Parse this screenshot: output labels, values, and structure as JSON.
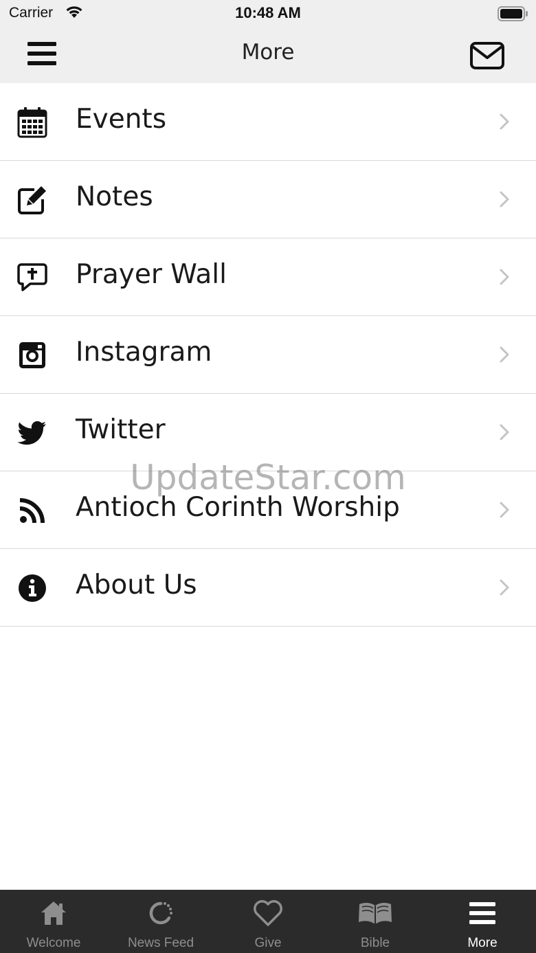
{
  "status_bar": {
    "carrier": "Carrier",
    "time": "10:48 AM"
  },
  "nav": {
    "title": "More"
  },
  "menu_items": [
    {
      "label": "Events",
      "icon": "calendar-icon"
    },
    {
      "label": "Notes",
      "icon": "edit-icon"
    },
    {
      "label": "Prayer Wall",
      "icon": "prayer-chat-icon"
    },
    {
      "label": "Instagram",
      "icon": "instagram-icon"
    },
    {
      "label": "Twitter",
      "icon": "twitter-icon"
    },
    {
      "label": "Antioch Corinth Worship",
      "icon": "rss-icon"
    },
    {
      "label": "About Us",
      "icon": "info-icon"
    }
  ],
  "watermark": "UpdateStar.com",
  "tabs": [
    {
      "label": "Welcome",
      "icon": "home-icon",
      "active": false
    },
    {
      "label": "News Feed",
      "icon": "refresh-icon",
      "active": false
    },
    {
      "label": "Give",
      "icon": "heart-icon",
      "active": false
    },
    {
      "label": "Bible",
      "icon": "book-icon",
      "active": false
    },
    {
      "label": "More",
      "icon": "menu-icon",
      "active": true
    }
  ],
  "colors": {
    "header_bg": "#efefef",
    "tab_bar_bg": "#2b2b2b",
    "tab_inactive": "#8e8e8e",
    "tab_active": "#ffffff",
    "divider": "#d9d9d9"
  }
}
